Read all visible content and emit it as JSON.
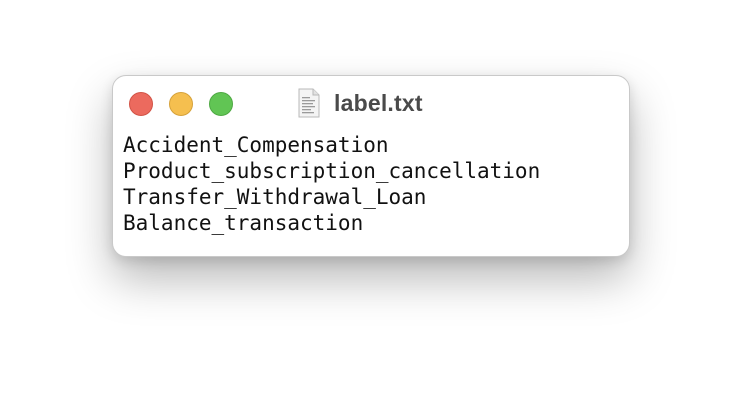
{
  "window": {
    "title": "label.txt",
    "file_icon": "text-document-icon",
    "traffic_lights": {
      "close_color": "#ec6a5e",
      "minimize_color": "#f5bf4f",
      "zoom_color": "#61c554"
    }
  },
  "content": {
    "lines": [
      "Accident_Compensation",
      "Product_subscription_cancellation",
      "Transfer_Withdrawal_Loan",
      "Balance_transaction"
    ]
  }
}
